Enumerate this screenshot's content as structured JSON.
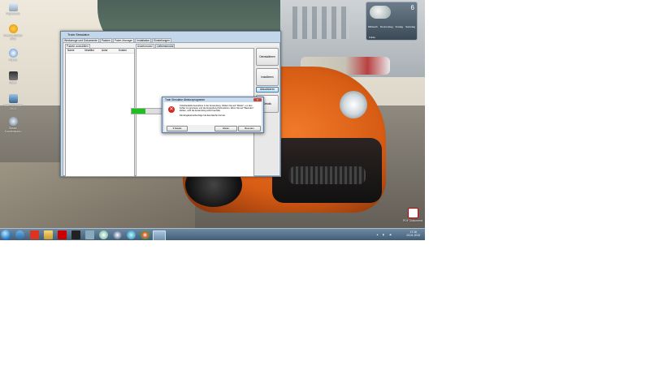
{
  "desktop": {
    "icons": [
      {
        "label": "Papierkorb"
      },
      {
        "label": "FreeFly-Büttün 2011"
      },
      {
        "label": "iTunes"
      },
      {
        "label": "Daten"
      },
      {
        "label": "Train Simulator 2013"
      },
      {
        "label": "Steam Kundenkonto"
      }
    ],
    "pdf_label": "PDF Dokument"
  },
  "weather": {
    "temp": "6",
    "days": [
      "Mittwoch",
      "Donnerstag",
      "Freitag",
      "Samstag"
    ],
    "city": "Fulda"
  },
  "app": {
    "title": "Train Simulator",
    "tabs": [
      "Werkzeuge und Dokumente",
      "Packen",
      "Paket-Manager",
      "Installation",
      "Einstellungen"
    ],
    "left_subtab": "Pakete auswählen",
    "columns": [
      "Name",
      "Inhaltlist",
      "Autor",
      "Kosten"
    ],
    "right_subtabs": [
      "Assetsmodul",
      "Liebensmodul"
    ],
    "buttons": {
      "uninstall": "Deinstallieren",
      "install": "Installieren",
      "refresh": "Aktualisieren",
      "details": "Details"
    },
    "progress": 0.12
  },
  "dialog": {
    "title": "Train Simulator Absturzprogramm",
    "close": "X",
    "message": "Unbehandelte Ausnahme in der Anwendung. Klicken Sie auf \"Weiter\", um den Fehler zu ignorieren und die Anwendung fortzusetzen. Wenn Sie auf \"Beenden\" klicken, wird die Anwendung sofort beendet.",
    "detail": "Die Eingabezeichenfolge hat das falsche Format.",
    "details_button": "Details",
    "continue_button": "Weiter",
    "quit_button": "Beenden"
  },
  "taskbar": {
    "time": "17:16",
    "date": "03.01.2013"
  }
}
